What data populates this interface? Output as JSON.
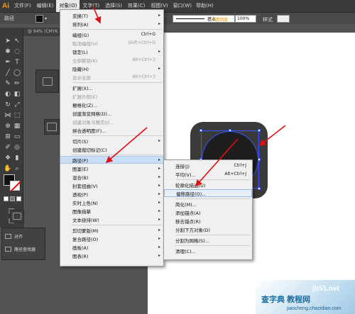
{
  "app": {
    "logo": "Ai"
  },
  "menubar": {
    "items": [
      "文件(F)",
      "编辑(E)",
      "对象(O)",
      "文字(T)",
      "选择(S)",
      "效果(C)",
      "视图(V)",
      "窗口(W)",
      "帮助(H)"
    ],
    "active_index": 2
  },
  "controlbar": {
    "label": "路径",
    "stroke_style_name": "基本",
    "opacity_label": "不透明度",
    "opacity_value": "100%",
    "style_label": "样式"
  },
  "document": {
    "tab_label": "@ 94% (CMYK"
  },
  "panels": {
    "align_label": "对齐",
    "pathfinder_label": "路径查找器"
  },
  "object_menu": {
    "items": [
      {
        "label": "变换(T)",
        "shortcut": "",
        "submenu": true,
        "disabled": false
      },
      {
        "label": "排列(A)",
        "shortcut": "",
        "submenu": true,
        "disabled": false
      },
      {
        "sep": true
      },
      {
        "label": "编组(G)",
        "shortcut": "Ctrl+G",
        "submenu": false,
        "disabled": false
      },
      {
        "label": "取消编组(U)",
        "shortcut": "Shift+Ctrl+G",
        "submenu": false,
        "disabled": true
      },
      {
        "label": "锁定(L)",
        "shortcut": "",
        "submenu": true,
        "disabled": false
      },
      {
        "label": "全部解锁(K)",
        "shortcut": "Alt+Ctrl+2",
        "submenu": false,
        "disabled": true
      },
      {
        "label": "隐藏(H)",
        "shortcut": "",
        "submenu": true,
        "disabled": false
      },
      {
        "label": "显示全部",
        "shortcut": "Alt+Ctrl+3",
        "submenu": false,
        "disabled": true
      },
      {
        "sep": true
      },
      {
        "label": "扩展(X)...",
        "shortcut": "",
        "submenu": false,
        "disabled": false
      },
      {
        "label": "扩展外观(E)",
        "shortcut": "",
        "submenu": false,
        "disabled": true
      },
      {
        "label": "栅格化(Z)...",
        "shortcut": "",
        "submenu": false,
        "disabled": false
      },
      {
        "label": "创建渐变网格(D)...",
        "shortcut": "",
        "submenu": false,
        "disabled": false
      },
      {
        "label": "创建对象马赛克(J)...",
        "shortcut": "",
        "submenu": false,
        "disabled": true
      },
      {
        "label": "拼合透明度(F)...",
        "shortcut": "",
        "submenu": false,
        "disabled": false
      },
      {
        "sep": true
      },
      {
        "label": "切片(S)",
        "shortcut": "",
        "submenu": true,
        "disabled": false
      },
      {
        "label": "创建裁切标记(C)",
        "shortcut": "",
        "submenu": false,
        "disabled": false
      },
      {
        "sep": true
      },
      {
        "label": "路径(P)",
        "shortcut": "",
        "submenu": true,
        "disabled": false,
        "highlight": true
      },
      {
        "label": "图案(E)",
        "shortcut": "",
        "submenu": true,
        "disabled": false
      },
      {
        "label": "混合(B)",
        "shortcut": "",
        "submenu": true,
        "disabled": false
      },
      {
        "label": "封套扭曲(V)",
        "shortcut": "",
        "submenu": true,
        "disabled": false
      },
      {
        "label": "透视(P)",
        "shortcut": "",
        "submenu": true,
        "disabled": false
      },
      {
        "label": "实时上色(N)",
        "shortcut": "",
        "submenu": true,
        "disabled": false
      },
      {
        "label": "图像描摹",
        "shortcut": "",
        "submenu": true,
        "disabled": false
      },
      {
        "label": "文本绕排(W)",
        "shortcut": "",
        "submenu": true,
        "disabled": false
      },
      {
        "sep": true
      },
      {
        "label": "剪切蒙版(M)",
        "shortcut": "",
        "submenu": true,
        "disabled": false
      },
      {
        "label": "复合路径(O)",
        "shortcut": "",
        "submenu": true,
        "disabled": false
      },
      {
        "label": "画板(A)",
        "shortcut": "",
        "submenu": true,
        "disabled": false
      },
      {
        "label": "图表(R)",
        "shortcut": "",
        "submenu": true,
        "disabled": false
      }
    ]
  },
  "path_submenu": {
    "items": [
      {
        "label": "连接(J)",
        "shortcut": "Ctrl+J"
      },
      {
        "label": "平均(V)...",
        "shortcut": "Alt+Ctrl+J"
      },
      {
        "sep": true
      },
      {
        "label": "轮廓化描边(U)",
        "shortcut": ""
      },
      {
        "label": "偏移路径(O)...",
        "shortcut": "",
        "highlight": true
      },
      {
        "sep": true
      },
      {
        "label": "简化(M)...",
        "shortcut": ""
      },
      {
        "label": "添加锚点(A)",
        "shortcut": ""
      },
      {
        "label": "移去锚点(R)",
        "shortcut": ""
      },
      {
        "label": "分割下方对象(D)",
        "shortcut": ""
      },
      {
        "sep": true
      },
      {
        "label": "分割为网格(S)...",
        "shortcut": ""
      },
      {
        "sep": true
      },
      {
        "label": "清理(C)...",
        "shortcut": ""
      }
    ]
  },
  "watermark": {
    "line1": "查字典",
    "line2": "教程网",
    "site": "jb51.net",
    "url": "jiaocheng.chazidian.com"
  },
  "colors": {
    "ui_dark": "#3a3a3a",
    "accent_orange": "#ff9a00",
    "selection_blue": "#3b54ff",
    "arrow_red": "#e01010",
    "menu_highlight": "#c9def5"
  }
}
